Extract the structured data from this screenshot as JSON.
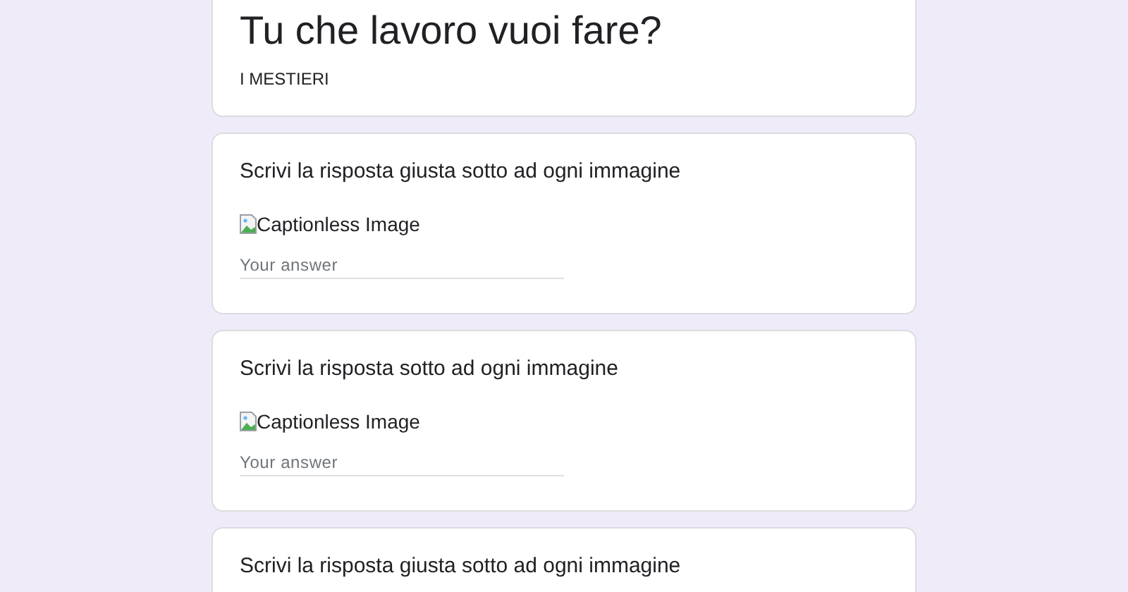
{
  "header": {
    "title": "Tu che lavoro vuoi fare?",
    "description": "I MESTIERI"
  },
  "questions": [
    {
      "text": "Scrivi la risposta giusta sotto ad ogni immagine",
      "image_alt": "Captionless Image",
      "placeholder": "Your answer"
    },
    {
      "text": "Scrivi la risposta sotto ad ogni immagine",
      "image_alt": "Captionless Image",
      "placeholder": "Your answer"
    },
    {
      "text": "Scrivi la risposta giusta sotto ad ogni immagine"
    }
  ]
}
